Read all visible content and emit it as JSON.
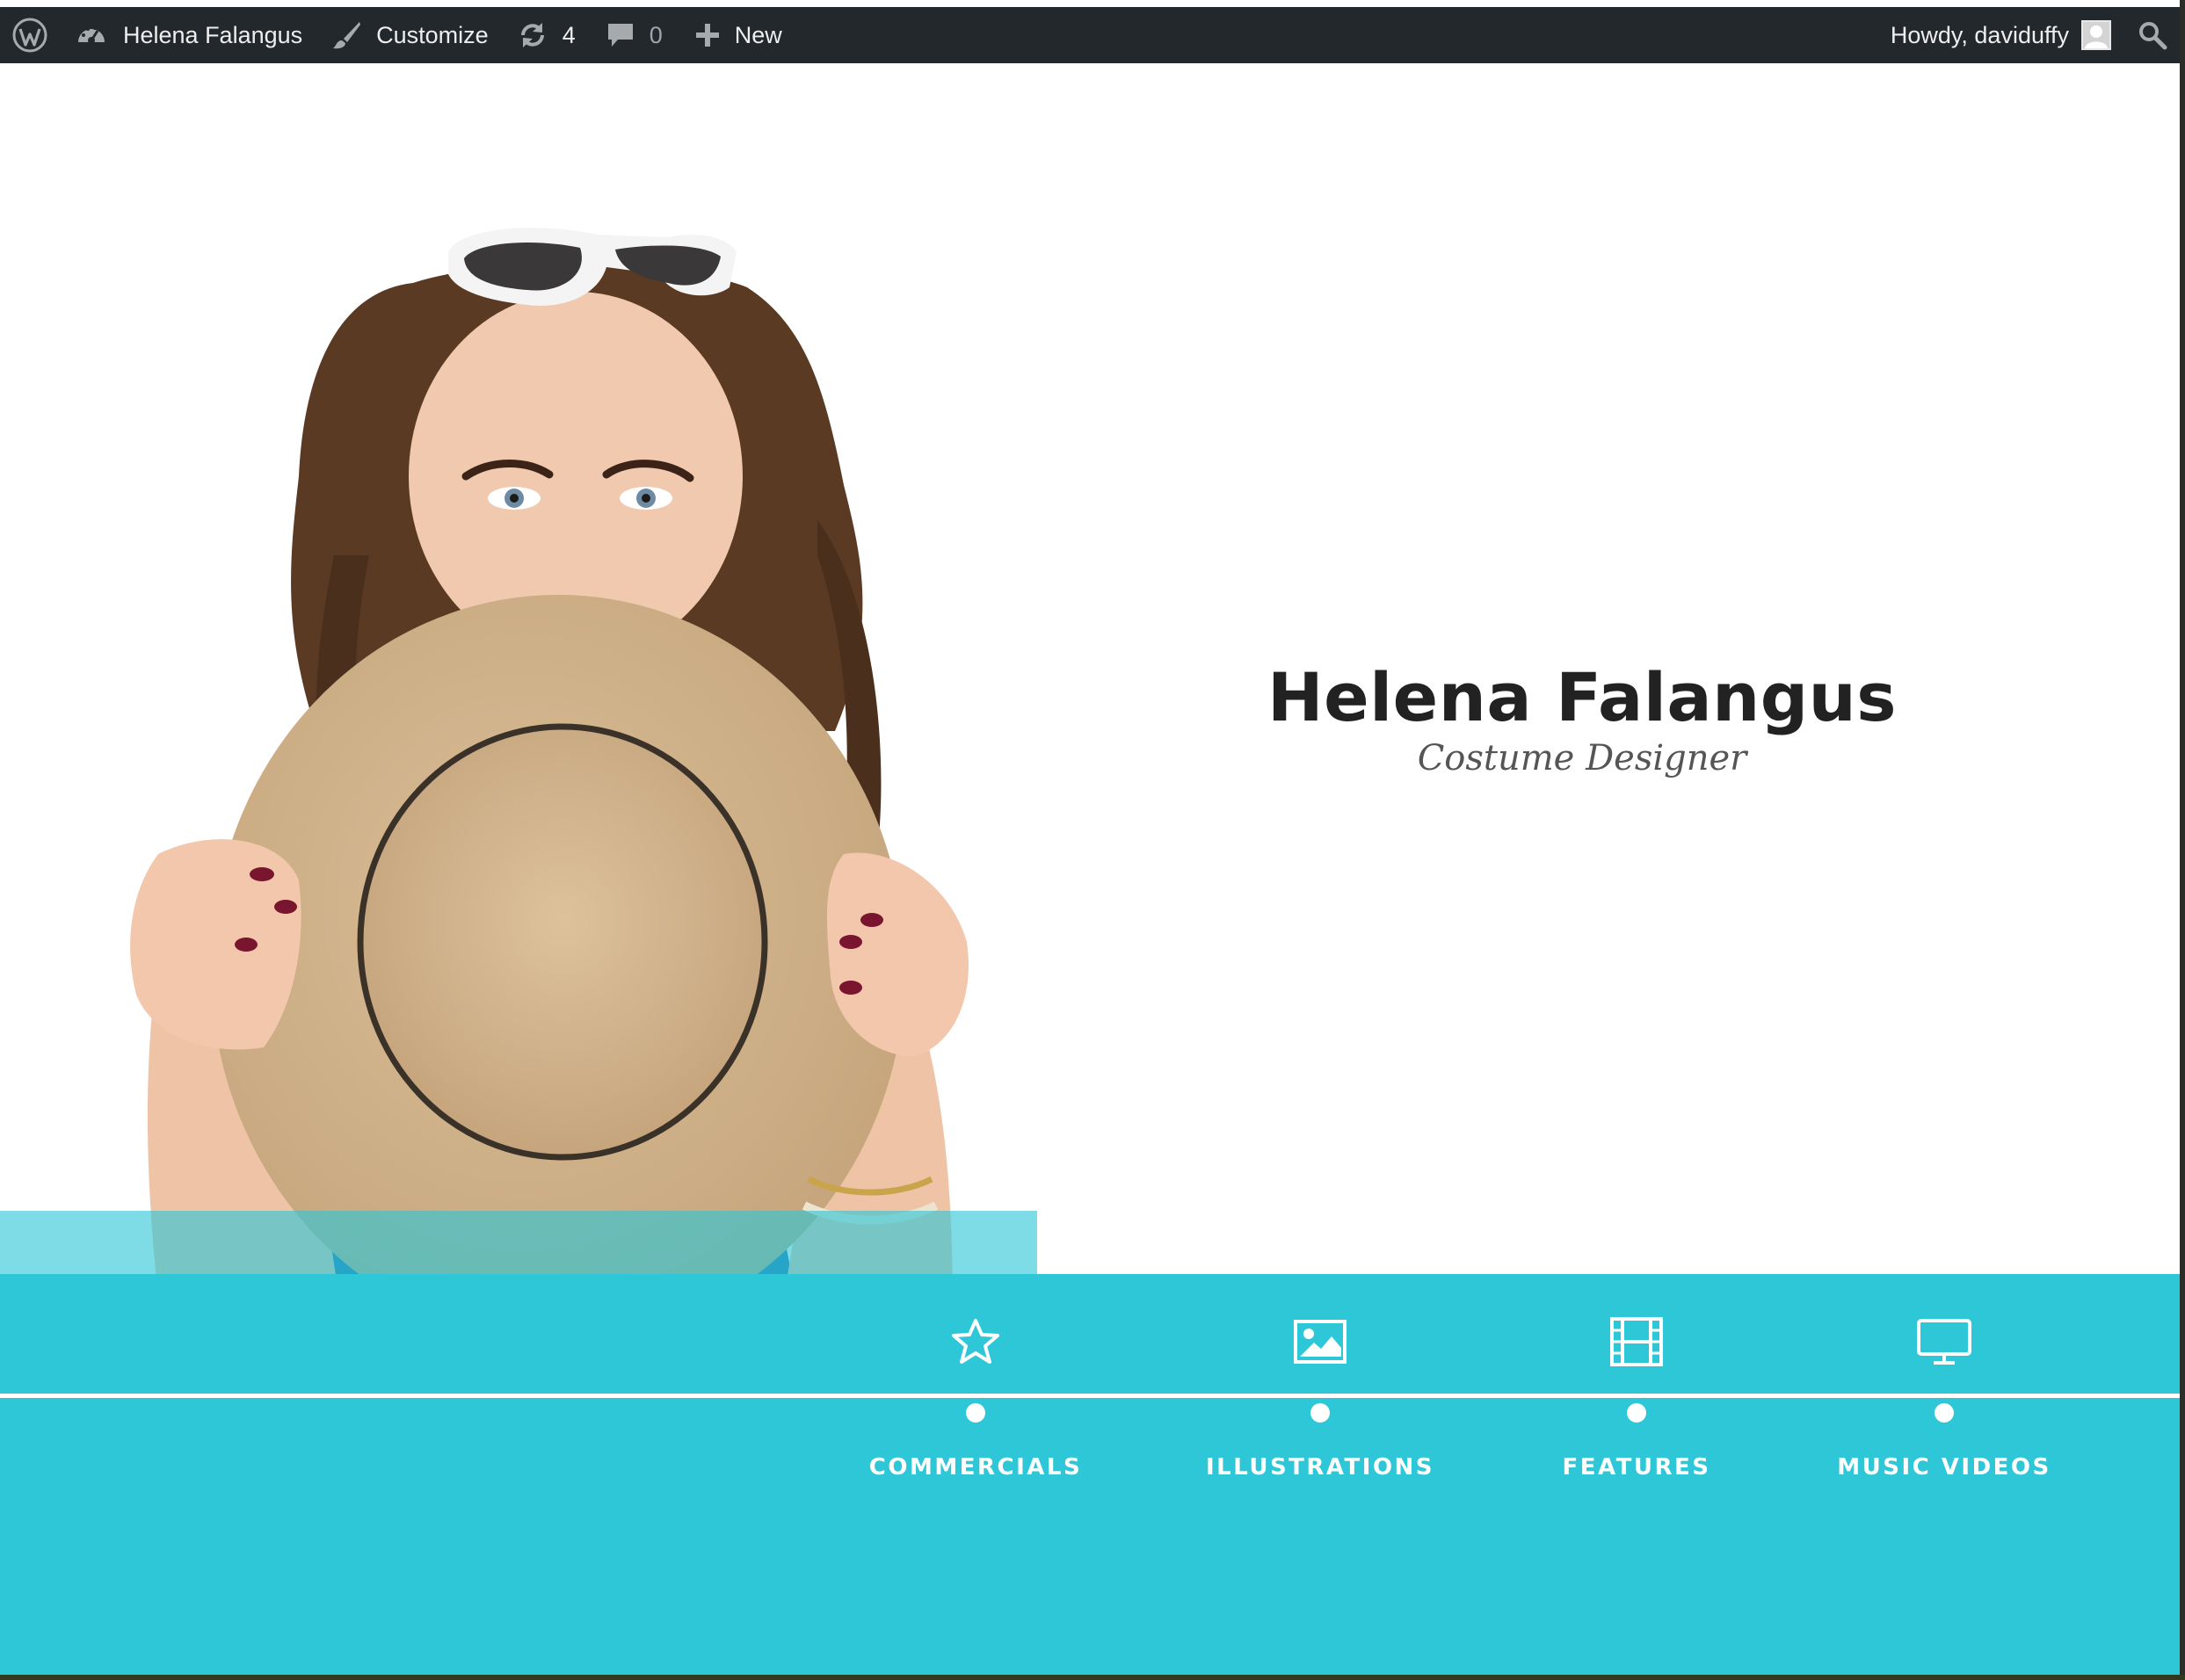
{
  "admin_bar": {
    "site_name": "Helena Falangus",
    "customize_label": "Customize",
    "updates_count": "4",
    "comments_count": "0",
    "new_label": "New",
    "greeting": "Howdy, daviduffy"
  },
  "hero": {
    "name": "Helena Falangus",
    "role": "Costume Designer"
  },
  "nav": {
    "items": [
      {
        "label": "COMMERCIALS",
        "icon": "star-icon"
      },
      {
        "label": "ILLUSTRATIONS",
        "icon": "image-icon"
      },
      {
        "label": "FEATURES",
        "icon": "film-icon"
      },
      {
        "label": "MUSIC VIDEOS",
        "icon": "monitor-icon"
      }
    ]
  },
  "colors": {
    "admin_bar": "#23282d",
    "accent": "#2dc7d7",
    "hat": "#d2b48c"
  }
}
